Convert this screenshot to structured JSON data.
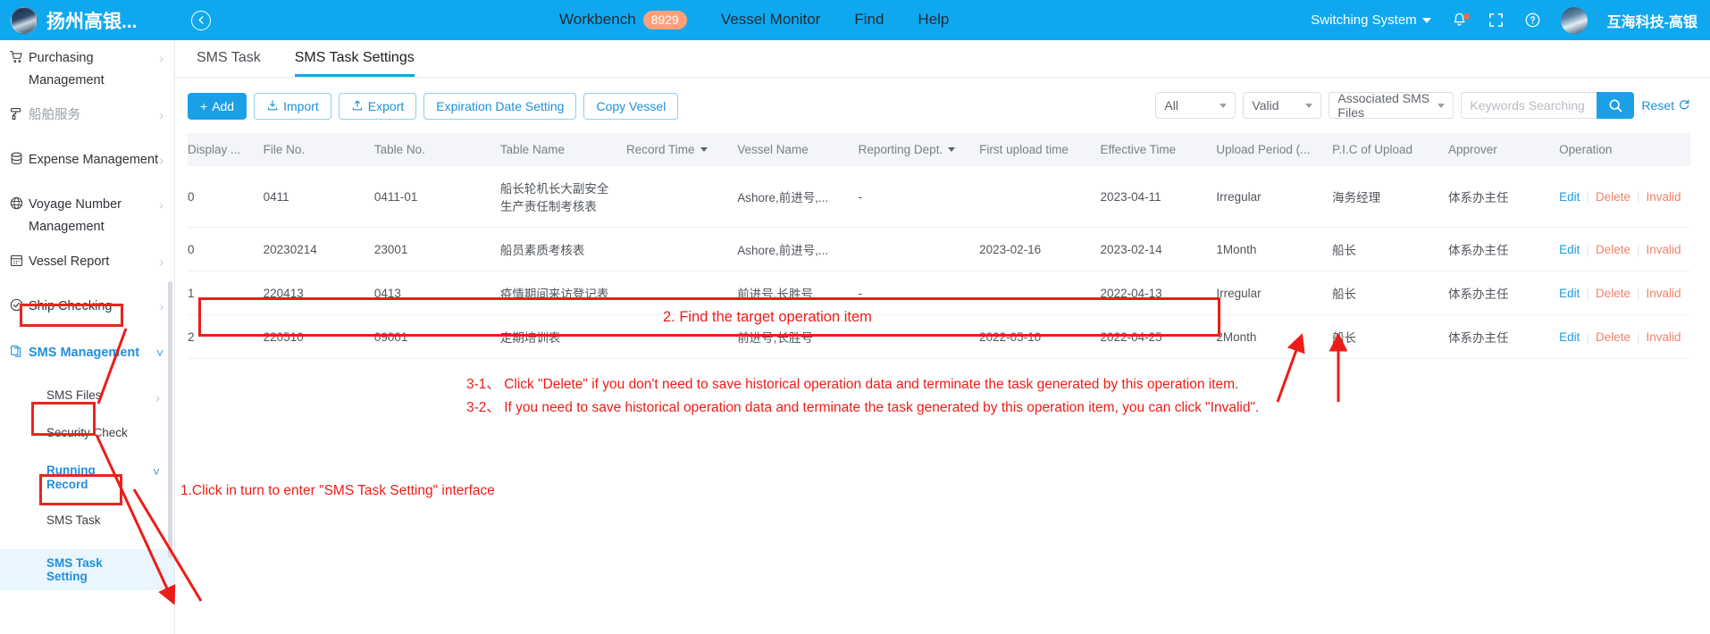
{
  "topbar": {
    "brand_name": "扬州高银...",
    "collapse_icon": "collapse-left-icon",
    "nav": [
      {
        "label": "Workbench",
        "badge": "8929"
      },
      {
        "label": "Vessel Monitor",
        "badge": ""
      },
      {
        "label": "Find",
        "badge": ""
      },
      {
        "label": "Help",
        "badge": ""
      }
    ],
    "switching_system": "Switching System",
    "icons": [
      "bell-icon",
      "fullscreen-icon",
      "help-circle-icon"
    ],
    "company": "互海科技-高银"
  },
  "sidebar": {
    "items": [
      {
        "label": "Purchasing Management",
        "icon": "cart-icon",
        "arrow": "chevron-right",
        "dim": false
      },
      {
        "label": "船舶服务",
        "icon": "ship-service-icon",
        "arrow": "chevron-right",
        "dim": true
      },
      {
        "label": "Expense Management",
        "icon": "database-icon",
        "arrow": "chevron-right",
        "dim": false
      },
      {
        "label": "Voyage Number Management",
        "icon": "globe-icon",
        "arrow": "chevron-right",
        "dim": false
      },
      {
        "label": "Vessel Report",
        "icon": "calendar-icon",
        "arrow": "chevron-right",
        "dim": false
      },
      {
        "label": "Ship Checking",
        "icon": "check-circle-icon",
        "arrow": "chevron-right",
        "dim": false
      },
      {
        "label": "SMS Management",
        "icon": "documents-icon",
        "arrow": "chevron-down",
        "dim": false,
        "active": true
      }
    ],
    "sub_items": [
      {
        "label": "SMS Files",
        "arrow": "chevron-right"
      },
      {
        "label": "Security Check",
        "arrow": ""
      },
      {
        "label": "Running Record",
        "arrow": "chevron-down",
        "highlight": true
      },
      {
        "label": "SMS Task",
        "arrow": ""
      },
      {
        "label": "SMS Task Setting",
        "arrow": "",
        "selected": true,
        "highlight": true
      }
    ]
  },
  "tabs": [
    {
      "label": "SMS Task",
      "active": false
    },
    {
      "label": "SMS Task Settings",
      "active": true
    }
  ],
  "toolbar": {
    "add": "Add",
    "import": "Import",
    "export": "Export",
    "expiration": "Expiration Date Setting",
    "copy_vessel": "Copy Vessel"
  },
  "filters": {
    "all": "All",
    "valid": "Valid",
    "associated": "Associated SMS Files",
    "search_placeholder": "Keywords Searching",
    "search_value": "",
    "reset": "Reset"
  },
  "table": {
    "headers": [
      {
        "label": "Display ...",
        "sortable": false
      },
      {
        "label": "File No.",
        "sortable": false
      },
      {
        "label": "Table No.",
        "sortable": false
      },
      {
        "label": "Table Name",
        "sortable": false
      },
      {
        "label": "Record Time",
        "sortable": true
      },
      {
        "label": "Vessel Name",
        "sortable": false
      },
      {
        "label": "Reporting Dept.",
        "sortable": true
      },
      {
        "label": "First upload time",
        "sortable": false
      },
      {
        "label": "Effective Time",
        "sortable": false
      },
      {
        "label": "Upload Period (...",
        "sortable": false
      },
      {
        "label": "P.I.C of Upload",
        "sortable": false
      },
      {
        "label": "Approver",
        "sortable": false
      },
      {
        "label": "Operation",
        "sortable": false
      }
    ],
    "rows": [
      {
        "display": "0",
        "file_no": "0411",
        "table_no": "0411-01",
        "table_name": "船长轮机长大副安全生产责任制考核表",
        "record_time": "",
        "vessel_name": "Ashore,前进号,...",
        "reporting_dept": "-",
        "first_upload": "",
        "effective_time": "2023-04-11",
        "upload_period": "Irregular",
        "pic": "海务经理",
        "approver": "体系办主任",
        "actions": [
          "Edit",
          "Delete",
          "Invalid"
        ]
      },
      {
        "display": "0",
        "file_no": "20230214",
        "table_no": "23001",
        "table_name": "船员素质考核表",
        "record_time": "",
        "vessel_name": "Ashore,前进号,...",
        "reporting_dept": "",
        "first_upload": "2023-02-16",
        "effective_time": "2023-02-14",
        "upload_period": "1Month",
        "pic": "船长",
        "approver": "体系办主任",
        "actions": [
          "Edit",
          "Delete",
          "Invalid"
        ]
      },
      {
        "display": "1",
        "file_no": "220413",
        "table_no": "0413",
        "table_name": "疫情期间来访登记表",
        "record_time": "",
        "vessel_name": "前进号,长胜号",
        "reporting_dept": "-",
        "first_upload": "",
        "effective_time": "2022-04-13",
        "upload_period": "Irregular",
        "pic": "船长",
        "approver": "体系办主任",
        "actions": [
          "Edit",
          "Delete",
          "Invalid"
        ]
      },
      {
        "display": "2",
        "file_no": "220510",
        "table_no": "09001",
        "table_name": "定期培训表",
        "record_time": "",
        "vessel_name": "前进号,长胜号",
        "reporting_dept": "",
        "first_upload": "2022-05-10",
        "effective_time": "2022-04-25",
        "upload_period": "2Month",
        "pic": "船长",
        "approver": "体系办主任",
        "actions": [
          "Edit",
          "Delete",
          "Invalid"
        ],
        "highlighted": true
      }
    ]
  },
  "annotations": {
    "step1": "1.Click in turn to enter \"SMS Task Setting\" interface",
    "step2": "2. Find the target operation item",
    "step3_1": "3-1、 Click \"Delete\" if you don't need to save historical operation data and terminate the task generated by this operation item.",
    "step3_2": "3-2、 If you need to save historical operation data and terminate the task generated by this operation item, you can click \"Invalid\"."
  },
  "colors": {
    "brand_blue": "#0fa8ef",
    "accent_blue": "#1ba0e8",
    "annotation_red": "#ee1c17",
    "badge_orange": "#ffa07a",
    "action_orange": "#f0836a"
  }
}
